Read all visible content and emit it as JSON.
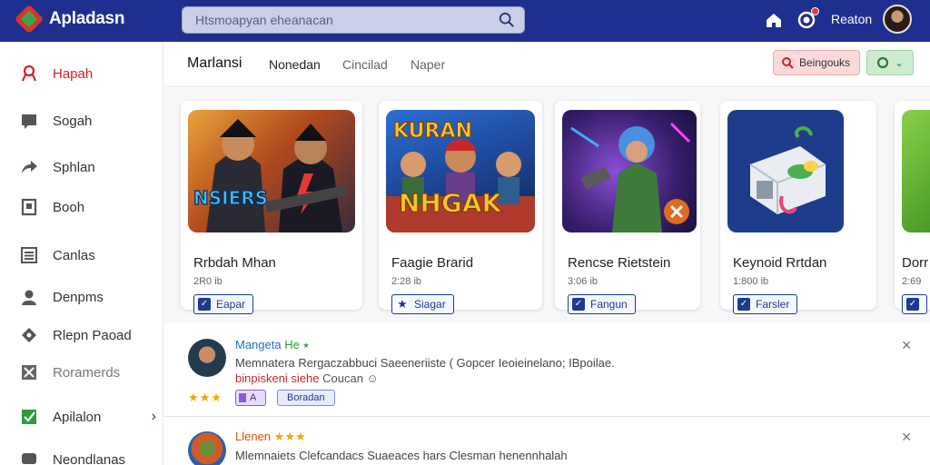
{
  "app": {
    "logo_text": "Apladasn",
    "search_placeholder": "Htsmoapyan eheanacan",
    "user_name": "Reaton",
    "accent": "#1f2f8f",
    "active_color": "#d3202a"
  },
  "sidebar": {
    "items": [
      {
        "label": "Hapah",
        "icon": "award-icon"
      },
      {
        "label": "Sogah",
        "icon": "chat-icon"
      },
      {
        "label": "Sphlan",
        "icon": "share-arrow-icon"
      },
      {
        "label": "Booh",
        "icon": "book-icon"
      },
      {
        "label": "Canlas",
        "icon": "list-icon"
      },
      {
        "label": "Denpms",
        "icon": "person-icon"
      },
      {
        "label": "Rlepn Paoad",
        "icon": "tag-icon"
      },
      {
        "label": "Roramerds",
        "icon": "tools-icon"
      },
      {
        "label": "Apilalon",
        "icon": "check-box-icon"
      },
      {
        "label": "Neondlanas",
        "icon": "chat-bubble-icon"
      }
    ]
  },
  "tabs": [
    "Marlansi",
    "Nonedan",
    "Cincilad",
    "Naper"
  ],
  "actions": {
    "red_button": "Beingouks",
    "green_button": ""
  },
  "cards": [
    {
      "title": "Rrbdah Mhan",
      "meta": "2R0 ib",
      "button": "Eapar",
      "art": "NSIERS"
    },
    {
      "title": "Faagie Brarid",
      "meta": "2:28 ib",
      "button": "Siagar",
      "art": "NHGAK"
    },
    {
      "title": "Rencse Rietstein",
      "meta": "3:06 ib",
      "button": "Fangun",
      "art": ""
    },
    {
      "title": "Keynoid Rrtdan",
      "meta": "1:800 ib",
      "button": "Farsler",
      "art": ""
    },
    {
      "title": "Dorr",
      "meta": "2:69",
      "button": "",
      "art": ""
    }
  ],
  "reviews": [
    {
      "name": "Mangeta",
      "name_suffix": "He ⭑",
      "text": "Memnatera Rergaczabbuci Saeeneriiste ( Gopcer Ieoieinelano; IBpoilae.",
      "sub": "binpiskeni siehe",
      "sub_after": "Coucan ☺",
      "stars": "★★★",
      "chip": "A",
      "tag": "Boradan"
    },
    {
      "name": "Llenen",
      "name_suffix": "★★★",
      "text": "Mlemnaiets Clefcandacs Suaeaces hars Clesman henennhalah",
      "sub": "",
      "sub_after": "",
      "stars": "",
      "chip": "",
      "tag": ""
    }
  ]
}
